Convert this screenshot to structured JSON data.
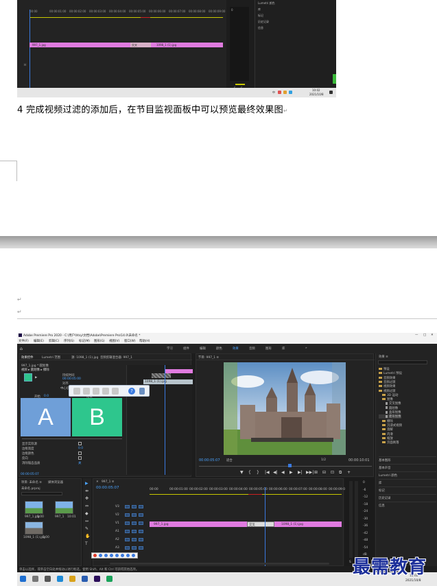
{
  "doc": {
    "caption_step": "4",
    "caption_text": "完成视频过滤的添加后，在节目监视面板中可以预览最终效果图",
    "return_mark": "↵"
  },
  "top_shot": {
    "ruler_ticks": [
      "00:00",
      "00:00:01:00",
      "00:00:02:00",
      "00:00:03:00",
      "00:00:04:00",
      "00:00:05:00",
      "00:00:06:00",
      "00:00:07:00",
      "00:00:08:00",
      "00:00:09:00"
    ],
    "clip_a": "997_1.jpg",
    "transition": "交叉",
    "clip_b": "1098_1 (1).jpg",
    "meter_zero": "0",
    "meter_s": "S",
    "panel_items": [
      "Lumetri 颜色",
      "库",
      "标记",
      "历史记录",
      "信息"
    ],
    "taskbar_time": "10:02",
    "taskbar_date": "2021/10/8",
    "ime_lang": "中"
  },
  "app": {
    "title": "Adobe Premiere Pro 2020 - C:\\用户\\htsy\\文档\\Adobe\\Premiere Pro\\14.0\\未命名 *",
    "menu": [
      "文件(F)",
      "编辑(E)",
      "剪辑(C)",
      "序列(S)",
      "标记(M)",
      "图形(G)",
      "视图(V)",
      "窗口(W)",
      "帮助(H)"
    ],
    "workspaces": [
      "学习",
      "组件",
      "编辑",
      "颜色",
      "效果",
      "音频",
      "图形",
      "库"
    ],
    "active_workspace": "效果",
    "effect_controls": {
      "tabs": [
        "效果控件",
        "Lumetri 范围",
        "源: 1098_1 (1).jpg",
        "音频剪辑混合器: 997_1"
      ],
      "clip_path": "997_1.jpg * 圆划像",
      "effect_line": "视频 ▸ 圆划像 ▸ 擦除",
      "mini_time": "00:00:05:00",
      "duration_label": "持续时间",
      "align_label": "对齐",
      "align_value": "中心切入",
      "start_label": "开始",
      "start_val": "0.0",
      "end_label": "结束",
      "end_val": "100.0",
      "a": "A",
      "b": "B",
      "props": [
        {
          "label": "显示实际源",
          "val": ""
        },
        {
          "label": "边框宽度",
          "val": "0.0"
        },
        {
          "label": "边框颜色",
          "val": ""
        },
        {
          "label": "反向",
          "val": ""
        },
        {
          "label": "消除锯齿品质",
          "val": "关"
        }
      ],
      "tl_clip": "1098_1 (1).jpg",
      "bottom_time": "00:00:05:07"
    },
    "program_monitor": {
      "tab": "节目: 997_1 ≡",
      "timecode": "00:00:05:07",
      "fit": "适合",
      "quality": "1/2",
      "duration": "00:00:10:01",
      "controls": [
        "▼",
        "{",
        "}",
        "|◀",
        "◀|",
        "◀",
        "▶",
        "▶|",
        "▶▶|",
        "⊞",
        "⊟",
        "⊡",
        "⧉",
        "+"
      ]
    },
    "effects_panel": {
      "title": "效果 ≡",
      "search_hint": "",
      "tree": [
        {
          "label": "预设",
          "kind": "folder",
          "depth": 0
        },
        {
          "label": "Lumetri 预设",
          "kind": "folder",
          "depth": 0
        },
        {
          "label": "音频效果",
          "kind": "folder",
          "depth": 0
        },
        {
          "label": "音频过渡",
          "kind": "folder",
          "depth": 0
        },
        {
          "label": "视频效果",
          "kind": "folder",
          "depth": 0
        },
        {
          "label": "视频过渡",
          "kind": "folder",
          "depth": 0
        },
        {
          "label": "3D 运动",
          "kind": "folder",
          "depth": 1
        },
        {
          "label": "划像",
          "kind": "folder",
          "depth": 1
        },
        {
          "label": "交叉划像",
          "kind": "file",
          "depth": 2
        },
        {
          "label": "圆划像",
          "kind": "file",
          "depth": 2
        },
        {
          "label": "盒形划像",
          "kind": "file",
          "depth": 2
        },
        {
          "label": "菱形划像",
          "kind": "file",
          "depth": 2,
          "selected": true
        },
        {
          "label": "擦除",
          "kind": "folder",
          "depth": 1
        },
        {
          "label": "沉浸式视频",
          "kind": "folder",
          "depth": 1
        },
        {
          "label": "溶解",
          "kind": "folder",
          "depth": 1
        },
        {
          "label": "内滑",
          "kind": "folder",
          "depth": 1
        },
        {
          "label": "缩放",
          "kind": "folder",
          "depth": 1
        },
        {
          "label": "页面剥落",
          "kind": "folder",
          "depth": 1
        }
      ],
      "lower": [
        "基本图形",
        "基本声音",
        "Lumetri 颜色",
        "库",
        "标记",
        "历史记录",
        "信息"
      ]
    },
    "project": {
      "tabs": [
        "项目: 未命名 ≡",
        "媒体浏览器"
      ],
      "name": "未命名.prproj",
      "items": [
        {
          "name": "997_1.jpg",
          "dur": "5:00"
        },
        {
          "name": "997_1",
          "dur": "10:01"
        },
        {
          "name": "1098_1 (1).jpg",
          "dur": "5:00"
        }
      ]
    },
    "tools": [
      "▶",
      "⇹",
      "✥",
      "⇔",
      "◆",
      "↔",
      "✎",
      "✋",
      "T"
    ],
    "timeline": {
      "tab": "997_1 ≡",
      "timecode": "00:00:05:07",
      "ruler": [
        "00:00",
        "00:00:01:00",
        "00:00:02:00",
        "00:00:03:00",
        "00:00:04:00",
        "00:00:05:00",
        "00:00:06:00",
        "00:00:07:00",
        "00:00:08:00",
        "00:00:09:00"
      ],
      "tracks": [
        "V3",
        "V2",
        "V1",
        "A1",
        "A2",
        "A3"
      ],
      "master": "主声道",
      "master_val": "0.0",
      "clip_a": "997_1.jpg",
      "transition": "交叉",
      "clip_b": "1098_1 (1).jpg"
    },
    "meters_scale": [
      "0",
      "-6",
      "-12",
      "-18",
      "-24",
      "-30",
      "-36",
      "-42",
      "-48",
      "-54",
      "dB"
    ],
    "meters_bottom": [
      "S",
      "S"
    ],
    "status": "单击以选择，或单击空白处并拖动以进行框选。使用 Shift、Alt 和 Ctrl 可获得其他选项。",
    "taskbar_time": "10:02",
    "taskbar_date": "2021/10/8"
  },
  "watermark": "最需教育",
  "colors": {
    "accent_blue": "#4aa3ff",
    "clip_pink": "#e07be0",
    "a_blue": "#6f9fd8",
    "b_green": "#2ec68d",
    "watermark_blue": "#1c2f9a"
  }
}
